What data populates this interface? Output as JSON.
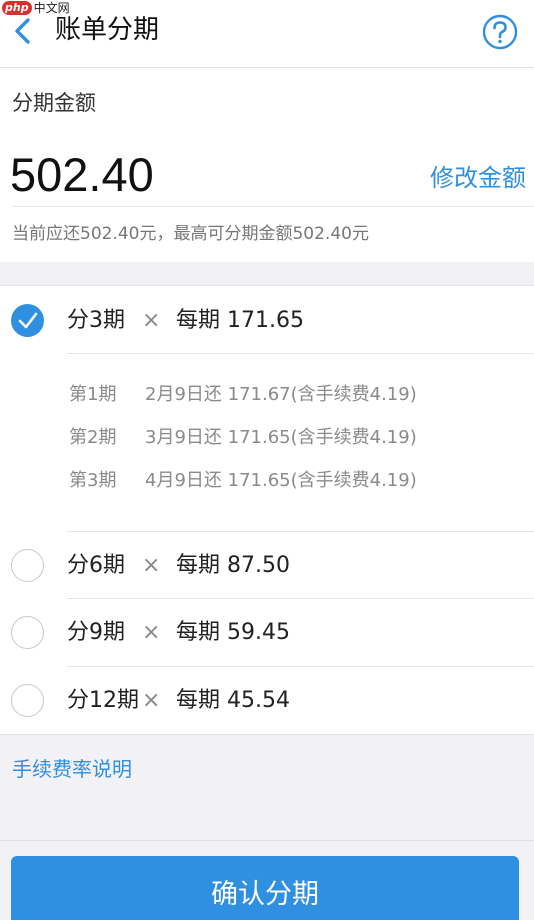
{
  "watermark": {
    "php": "php",
    "site": "中文网"
  },
  "header": {
    "title": "账单分期"
  },
  "amount": {
    "label": "分期金额",
    "value": "502.40",
    "modify_label": "修改金额",
    "note": "当前应还502.40元，最高可分期金额502.40元"
  },
  "options": [
    {
      "periods": "分3期",
      "times": "×",
      "per_label": "每期 171.65",
      "selected": true
    },
    {
      "periods": "分6期",
      "times": "×",
      "per_label": "每期 87.50",
      "selected": false
    },
    {
      "periods": "分9期",
      "times": "×",
      "per_label": "每期 59.45",
      "selected": false
    },
    {
      "periods": "分12期",
      "times": "×",
      "per_label": "每期 45.54",
      "selected": false
    }
  ],
  "details": [
    {
      "period": "第1期",
      "text": "2月9日还 171.67(含手续费4.19)"
    },
    {
      "period": "第2期",
      "text": "3月9日还 171.65(含手续费4.19)"
    },
    {
      "period": "第3期",
      "text": "4月9日还 171.65(含手续费4.19)"
    }
  ],
  "footer": {
    "fee_link": "手续费率说明",
    "confirm_label": "确认分期"
  },
  "colors": {
    "accent": "#2f8fe0",
    "background": "#f2f2f6"
  }
}
